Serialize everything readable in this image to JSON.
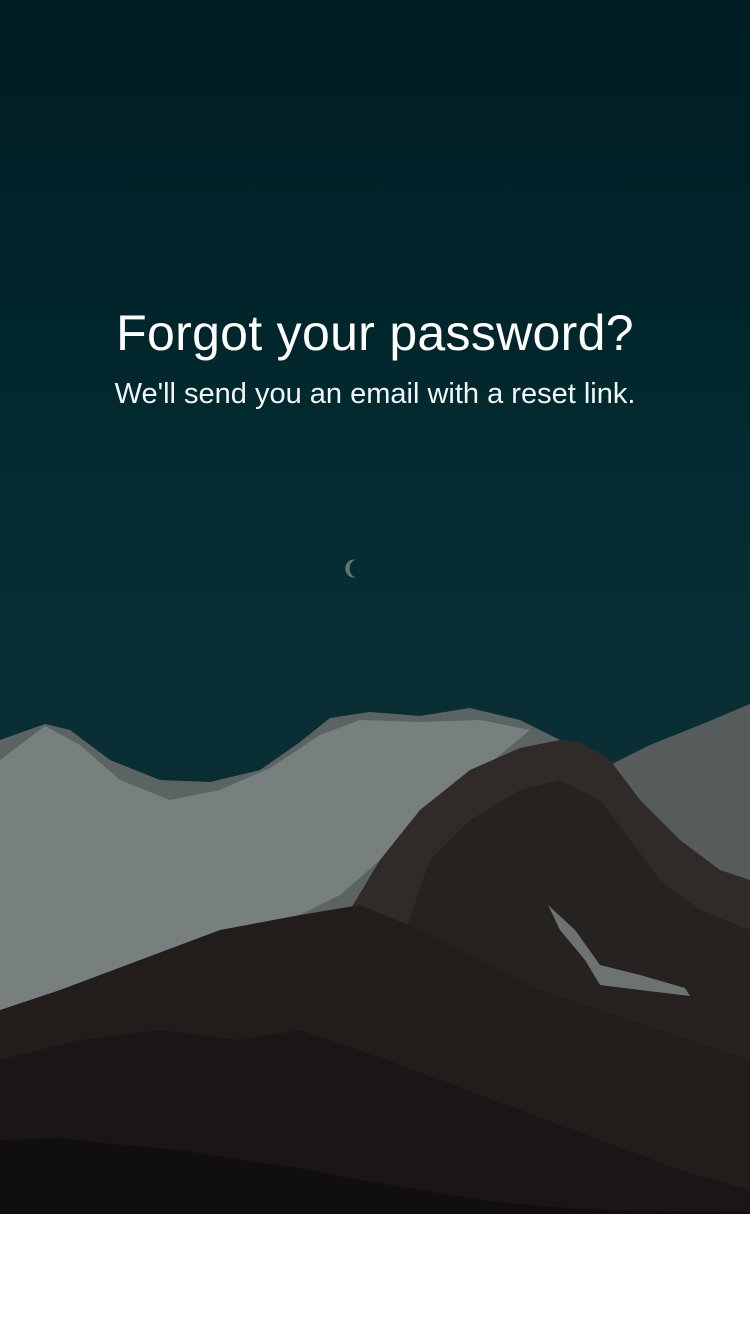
{
  "reset_screen": {
    "title": "Forgot your password?",
    "subtitle": "We'll send you an email with a reset link.",
    "background_image": "moon-over-snowy-mountains",
    "colors": {
      "sky_top": "#00252b",
      "sky_mid": "#0a3a40",
      "text": "#ffffff",
      "bottom_panel": "#ffffff"
    }
  }
}
